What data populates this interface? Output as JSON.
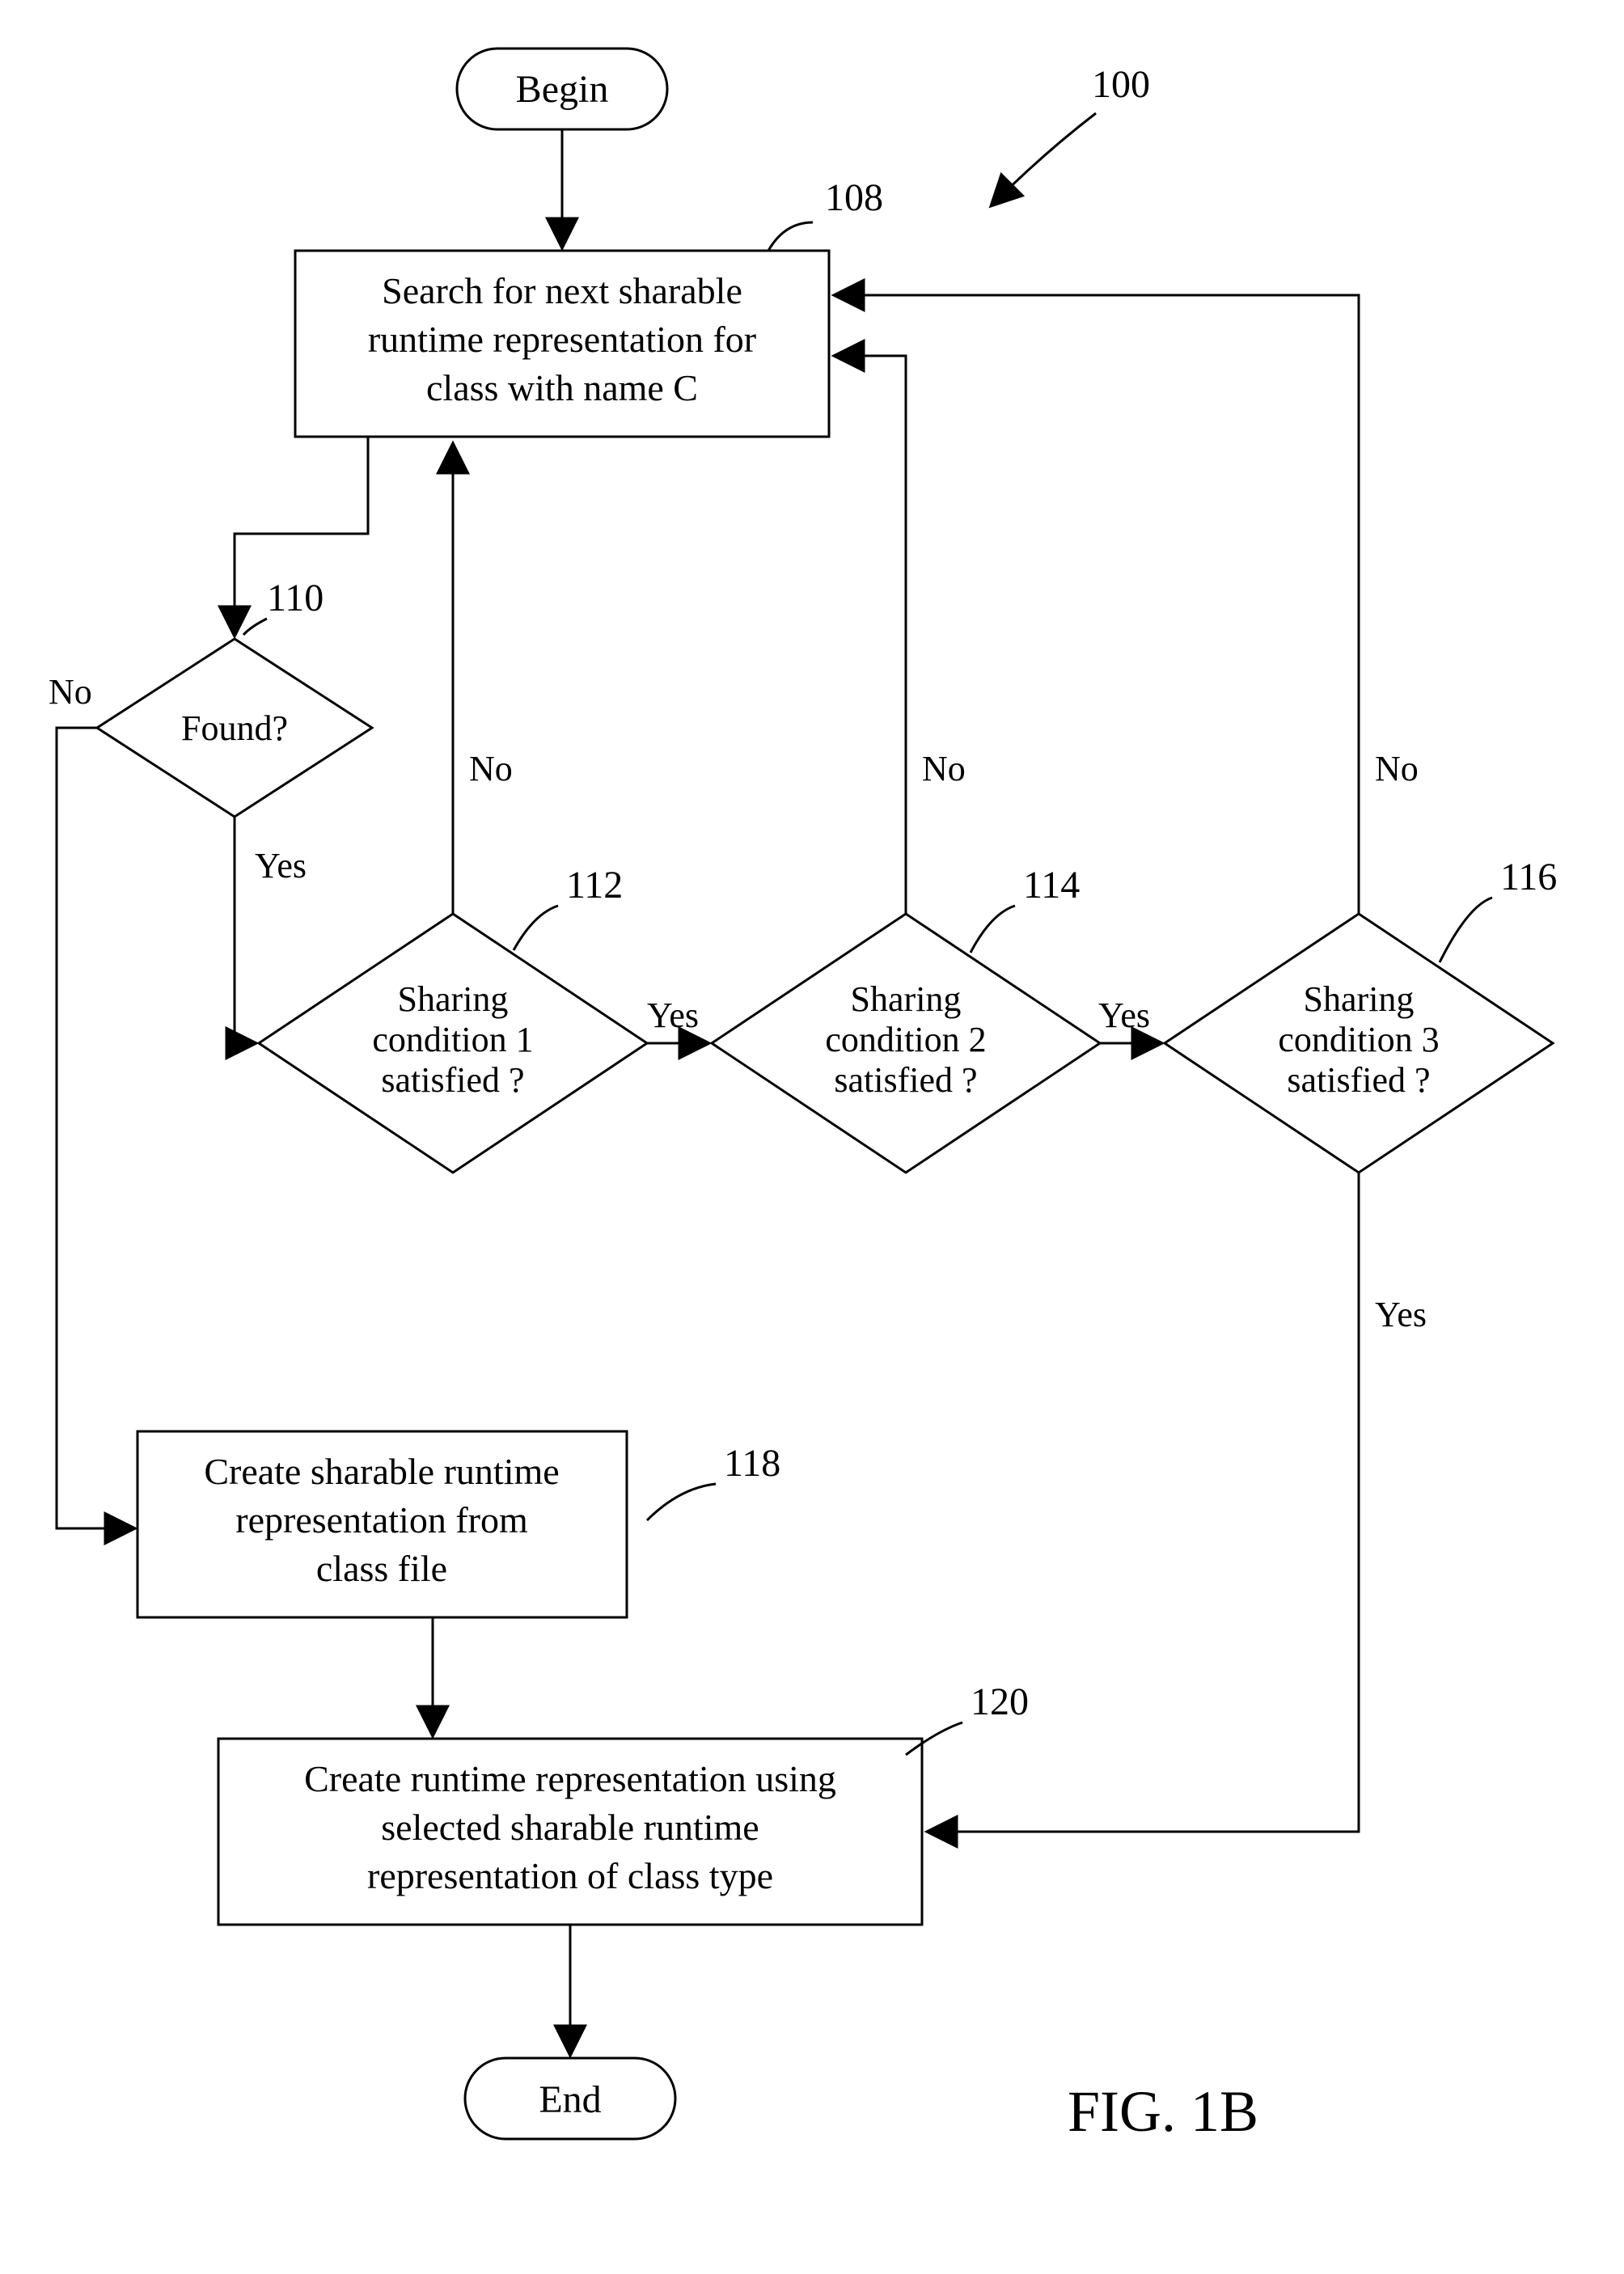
{
  "figure_label": "FIG. 1B",
  "ref_numerals": {
    "overall": "100",
    "search": "108",
    "found": "110",
    "cond1": "112",
    "cond2": "114",
    "cond3": "116",
    "create_sharable": "118",
    "create_runtime": "120"
  },
  "nodes": {
    "begin": "Begin",
    "end": "End",
    "search_l1": "Search for next sharable",
    "search_l2": "runtime representation for",
    "search_l3": "class with name C",
    "found": "Found?",
    "cond1_l1": "Sharing",
    "cond1_l2": "condition   1",
    "cond1_l3": "satisfied ?",
    "cond2_l1": "Sharing",
    "cond2_l2": "condition   2",
    "cond2_l3": "satisfied ?",
    "cond3_l1": "Sharing",
    "cond3_l2": "condition   3",
    "cond3_l3": "satisfied ?",
    "create_sharable_l1": "Create sharable runtime",
    "create_sharable_l2": "representation from",
    "create_sharable_l3": "class file",
    "create_runtime_l1": "Create runtime representation using",
    "create_runtime_l2": "selected sharable runtime",
    "create_runtime_l3": "representation of class type"
  },
  "edges": {
    "no": "No",
    "yes": "Yes"
  }
}
